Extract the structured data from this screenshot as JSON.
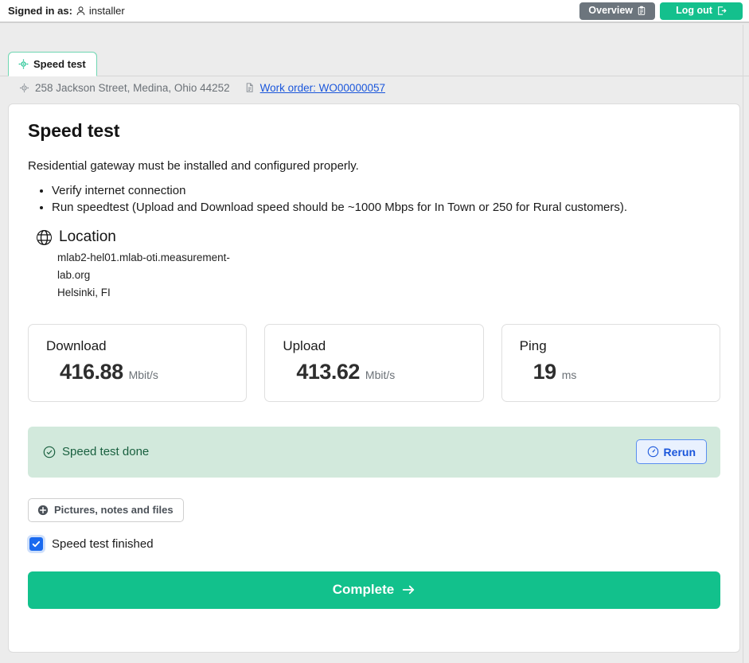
{
  "topbar": {
    "signed_in_label": "Signed in as:",
    "username": "installer",
    "user_icon": "person-icon",
    "overview_label": "Overview",
    "overview_icon": "clipboard-icon",
    "logout_label": "Log out",
    "logout_icon": "logout-icon"
  },
  "tabs": [
    {
      "label": "Speed test",
      "icon": "crosshair-icon",
      "active": true
    }
  ],
  "meta": {
    "address_icon": "crosshair-icon",
    "address": "258 Jackson Street, Medina, Ohio 44252",
    "work_order_icon": "document-icon",
    "work_order_label": "Work order: WO00000057"
  },
  "main": {
    "title": "Speed test",
    "intro": "Residential gateway must be installed and configured properly.",
    "checklist": [
      "Verify internet connection",
      "Run speedtest (Upload and Download speed should be ~1000 Mbps for In Town or 250 for Rural customers)."
    ],
    "location": {
      "icon": "globe-icon",
      "title": "Location",
      "host": "mlab2-hel01.mlab-oti.measurement-lab.org",
      "city": "Helsinki, FI"
    },
    "metrics": [
      {
        "label": "Download",
        "value": "416.88",
        "unit": "Mbit/s"
      },
      {
        "label": "Upload",
        "value": "413.62",
        "unit": "Mbit/s"
      },
      {
        "label": "Ping",
        "value": "19",
        "unit": "ms"
      }
    ],
    "status": {
      "icon": "check-circle-icon",
      "text": "Speed test done",
      "rerun_label": "Rerun",
      "rerun_icon": "gauge-icon"
    },
    "attachments": {
      "icon": "plus-circle-icon",
      "label": "Pictures, notes and files"
    },
    "finished_checkbox": {
      "label": "Speed test finished",
      "checked": true
    },
    "complete_button": {
      "label": "Complete",
      "icon": "arrow-right-icon"
    }
  },
  "colors": {
    "brand_green": "#12c18c",
    "tab_border_green": "#6fd6b2",
    "alert_bg": "#d2e9dc",
    "alert_text": "#19603f",
    "link_blue": "#1a56db",
    "checkbox_blue": "#1a6aef",
    "overview_gray": "#6c757d",
    "page_bg": "#ececec"
  }
}
